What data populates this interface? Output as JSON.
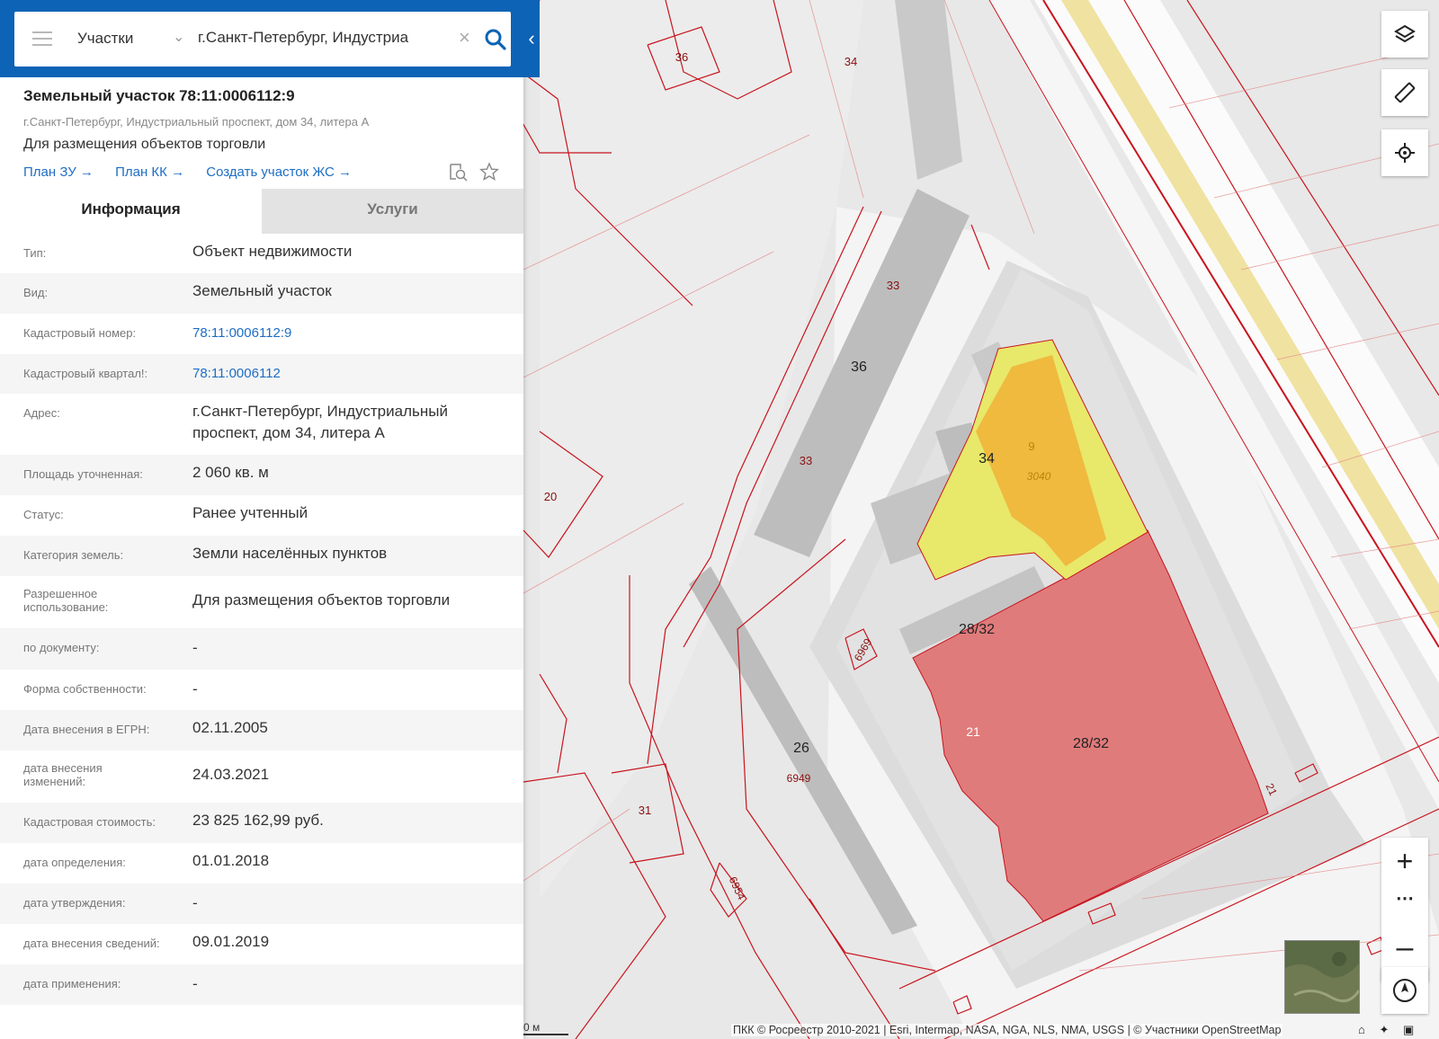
{
  "search": {
    "layer": "Участки",
    "query": "г.Санкт-Петербург, Индустриа"
  },
  "card": {
    "title": "Земельный участок 78:11:0006112:9",
    "address_small": "г.Санкт-Петербург, Индустриальный проспект, дом 34, литера А",
    "purpose": "Для размещения объектов торговли",
    "links": [
      "План ЗУ →",
      "План КК →",
      "Создать участок ЖС →"
    ]
  },
  "tabs": {
    "info": "Информация",
    "services": "Услуги"
  },
  "rows": [
    {
      "label": "Тип:",
      "value": "Объект недвижимости"
    },
    {
      "label": "Вид:",
      "value": "Земельный участок"
    },
    {
      "label": "Кадастровый номер:",
      "value": "78:11:0006112:9",
      "link": true
    },
    {
      "label": "Кадастровый квартал!:",
      "value": "78:11:0006112",
      "link": true
    },
    {
      "label": "Адрес:",
      "value": "г.Санкт-Петербург, Индустриальный проспект, дом 34, литера А"
    },
    {
      "label": "Площадь уточненная:",
      "value": "2 060 кв. м"
    },
    {
      "label": "Статус:",
      "value": "Ранее учтенный"
    },
    {
      "label": "Категория земель:",
      "value": "Земли населённых пунктов"
    },
    {
      "label": "Разрешенное использование:",
      "value": "Для размещения объектов торговли"
    },
    {
      "label": "по документу:",
      "value": "-"
    },
    {
      "label": "Форма собственности:",
      "value": "-"
    },
    {
      "label": "Дата внесения в ЕГРН:",
      "value": "02.11.2005"
    },
    {
      "label": "дата внесения изменений:",
      "value": "24.03.2021"
    },
    {
      "label": "Кадастровая стоимость:",
      "value": "23 825 162,99 руб."
    },
    {
      "label": "дата определения:",
      "value": "01.01.2018"
    },
    {
      "label": "дата утверждения:",
      "value": "-"
    },
    {
      "label": "дата внесения сведений:",
      "value": "09.01.2019"
    },
    {
      "label": "дата применения:",
      "value": "-"
    }
  ],
  "map": {
    "labels": [
      "36",
      "34",
      "33",
      "36",
      "33",
      "34",
      "9",
      "3040",
      "20",
      "28/32",
      "6969",
      "21",
      "28/32",
      "26",
      "6949",
      "31",
      "6954",
      "21"
    ],
    "scale": "0 м",
    "attribution": "ПКК © Росреестр 2010-2021 | Esri, Intermap, NASA, NGA, NLS, NMA, USGS | © Участники OpenStreetMap"
  },
  "colors": {
    "accent": "#0d63b5",
    "link": "#1e6ec4",
    "parcel_red": "#e07b7b",
    "parcel_yellow": "#e8e86a",
    "parcel_orange": "#efb53a",
    "boundary": "#c8141e"
  },
  "icons": [
    "menu-icon",
    "chevron-down-icon",
    "clear-icon",
    "search-icon",
    "collapse-icon",
    "print-preview-icon",
    "star-icon",
    "layers-icon",
    "ruler-icon",
    "locate-icon",
    "zoom-in-icon",
    "more-icon",
    "zoom-out-icon",
    "compass-icon",
    "home-icon"
  ]
}
